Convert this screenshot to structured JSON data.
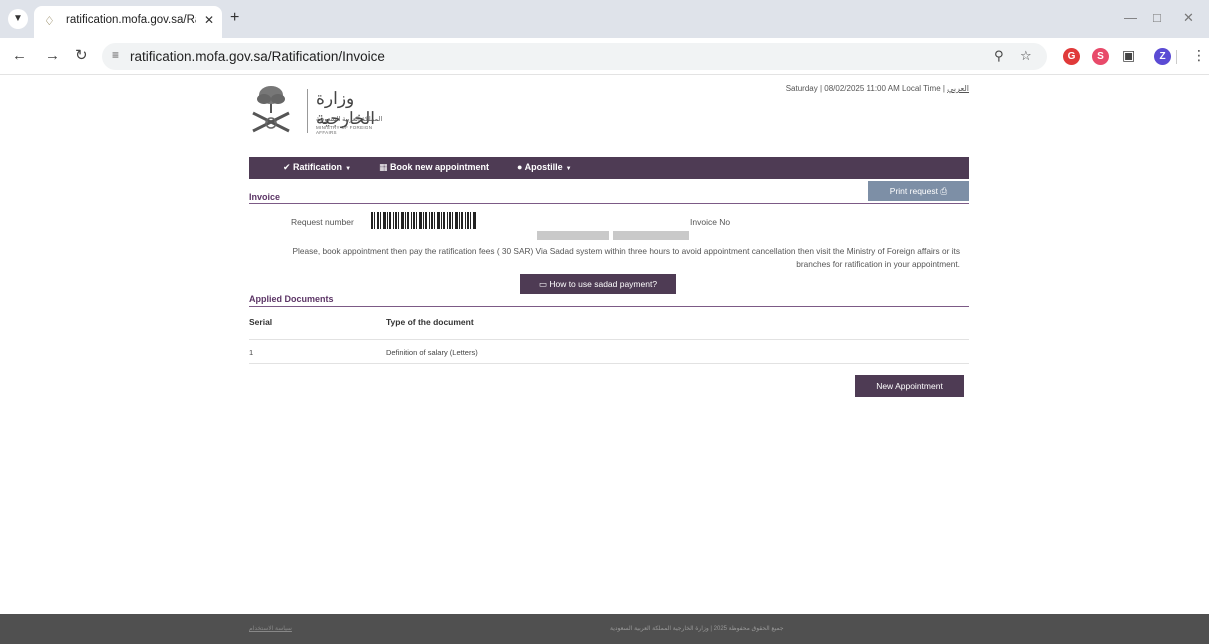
{
  "browser": {
    "tab_title": "ratification.mofa.gov.sa/Ratifica",
    "url": "ratification.mofa.gov.sa/Ratification/Invoice",
    "profile_initial": "Z",
    "extensions": [
      {
        "icon": "ext-red-g-icon",
        "color": "#e03a3a",
        "glyph": "G"
      },
      {
        "icon": "ext-red-circle-icon",
        "color": "#e84a6a",
        "glyph": "S"
      }
    ],
    "profile_color": "#5b4bd4"
  },
  "header": {
    "logo_ar": "وزارة الخارجية",
    "logo_sub": "المملكة العربية السعودية",
    "logo_en": "MINISTRY OF FOREIGN AFFAIRS",
    "datetime": "Saturday | 08/02/2025 11:00 AM Local Time |",
    "lang_link": "العربي"
  },
  "nav": {
    "ratification": "Ratification",
    "book": "Book new appointment",
    "apostille": "Apostille"
  },
  "invoice": {
    "section_title": "Invoice",
    "print_label": "Print request",
    "request_label": "Request number",
    "invoice_label": "Invoice No",
    "notice": "Please, book appointment then pay the ratification fees ( 30 SAR) Via Sadad system within three hours to avoid appointment cancellation then visit the Ministry of Foreign affairs or its branches for ratification in your appointment.",
    "sadad_label": "How to use sadad payment?"
  },
  "documents": {
    "section_title": "Applied Documents",
    "headers": [
      "Serial",
      "Type of the document"
    ],
    "rows": [
      {
        "serial": "1",
        "type": "Definition of salary (Letters)"
      }
    ]
  },
  "actions": {
    "new_appointment": "New Appointment"
  },
  "footer": {
    "link": "سياسة الاستخدام",
    "copyright": "جميع الحقوق محفوظة 2025 | وزارة الخارجية المملكة العربية السعودية"
  },
  "colors": {
    "brand_purple": "#4e3b54",
    "print_button": "#7d8fa6",
    "footer": "#505050"
  }
}
